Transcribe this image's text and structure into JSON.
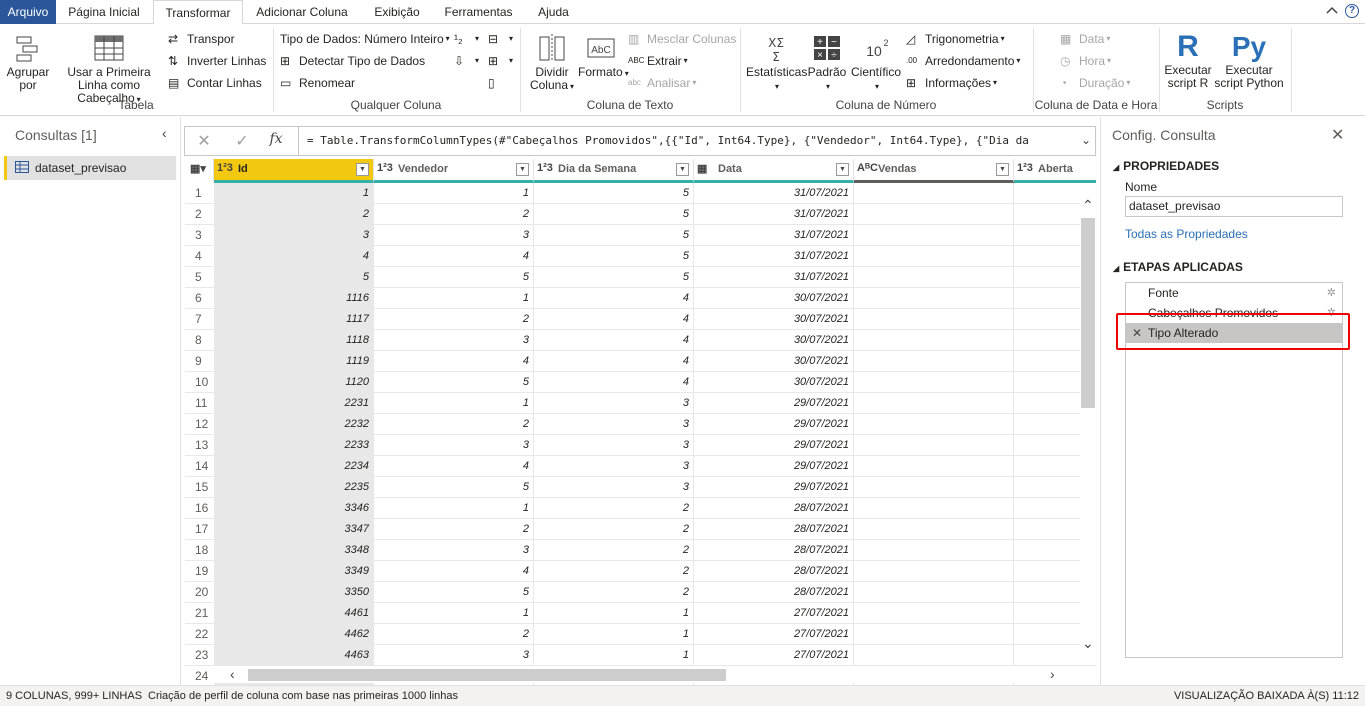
{
  "menu": {
    "tabs": [
      "Arquivo",
      "Página Inicial",
      "Transformar",
      "Adicionar Coluna",
      "Exibição",
      "Ferramentas",
      "Ajuda"
    ]
  },
  "ribbon": {
    "groups": {
      "tabela": "Tabela",
      "qualquer": "Qualquer Coluna",
      "texto": "Coluna de Texto",
      "numero": "Coluna de Número",
      "data": "Coluna de Data e Hora",
      "scripts": "Scripts"
    },
    "agrupar": "Agrupar por",
    "usar_linha": "Usar a Primeira Linha como Cabeçalho",
    "transpor": "Transpor",
    "inverter": "Inverter Linhas",
    "contar": "Contar Linhas",
    "tipo_dados": "Tipo de Dados: Número Inteiro",
    "detectar": "Detectar Tipo de Dados",
    "renomear": "Renomear",
    "dividir": "Dividir Coluna",
    "formato": "Formato",
    "mesclar": "Mesclar Colunas",
    "extrair": "Extrair",
    "analisar": "Analisar",
    "estatisticas": "Estatísticas",
    "padrao": "Padrão",
    "cientifico": "Científico",
    "trig": "Trigonometria",
    "arred": "Arredondamento",
    "info": "Informações",
    "data": "Data",
    "hora": "Hora",
    "duracao": "Duração",
    "script_r": "Executar script R",
    "script_py": "Executar script Python"
  },
  "queries": {
    "title": "Consultas [1]",
    "item": "dataset_previsao"
  },
  "formula": "= Table.TransformColumnTypes(#\"Cabeçalhos Promovidos\",{{\"Id\", Int64.Type}, {\"Vendedor\", Int64.Type}, {\"Dia da",
  "grid": {
    "columns": [
      {
        "type": "1²3",
        "name": "Id"
      },
      {
        "type": "1²3",
        "name": "Vendedor"
      },
      {
        "type": "1²3",
        "name": "Dia da Semana"
      },
      {
        "type": "▦",
        "name": "Data"
      },
      {
        "type": "AᴮC",
        "name": "Vendas"
      },
      {
        "type": "1²3",
        "name": "Aberta"
      }
    ],
    "rows": [
      [
        "1",
        "1",
        "1",
        "5",
        "31/07/2021"
      ],
      [
        "2",
        "2",
        "2",
        "5",
        "31/07/2021"
      ],
      [
        "3",
        "3",
        "3",
        "5",
        "31/07/2021"
      ],
      [
        "4",
        "4",
        "4",
        "5",
        "31/07/2021"
      ],
      [
        "5",
        "5",
        "5",
        "5",
        "31/07/2021"
      ],
      [
        "6",
        "1116",
        "1",
        "4",
        "30/07/2021"
      ],
      [
        "7",
        "1117",
        "2",
        "4",
        "30/07/2021"
      ],
      [
        "8",
        "1118",
        "3",
        "4",
        "30/07/2021"
      ],
      [
        "9",
        "1119",
        "4",
        "4",
        "30/07/2021"
      ],
      [
        "10",
        "1120",
        "5",
        "4",
        "30/07/2021"
      ],
      [
        "11",
        "2231",
        "1",
        "3",
        "29/07/2021"
      ],
      [
        "12",
        "2232",
        "2",
        "3",
        "29/07/2021"
      ],
      [
        "13",
        "2233",
        "3",
        "3",
        "29/07/2021"
      ],
      [
        "14",
        "2234",
        "4",
        "3",
        "29/07/2021"
      ],
      [
        "15",
        "2235",
        "5",
        "3",
        "29/07/2021"
      ],
      [
        "16",
        "3346",
        "1",
        "2",
        "28/07/2021"
      ],
      [
        "17",
        "3347",
        "2",
        "2",
        "28/07/2021"
      ],
      [
        "18",
        "3348",
        "3",
        "2",
        "28/07/2021"
      ],
      [
        "19",
        "3349",
        "4",
        "2",
        "28/07/2021"
      ],
      [
        "20",
        "3350",
        "5",
        "2",
        "28/07/2021"
      ],
      [
        "21",
        "4461",
        "1",
        "1",
        "27/07/2021"
      ],
      [
        "22",
        "4462",
        "2",
        "1",
        "27/07/2021"
      ],
      [
        "23",
        "4463",
        "3",
        "1",
        "27/07/2021"
      ],
      [
        "24",
        "",
        "",
        "",
        ""
      ]
    ]
  },
  "settings": {
    "title": "Config. Consulta",
    "props": "PROPRIEDADES",
    "name_label": "Nome",
    "name_value": "dataset_previsao",
    "all_props": "Todas as Propriedades",
    "steps_title": "ETAPAS APLICADAS",
    "steps": [
      "Fonte",
      "Cabeçalhos Promovidos",
      "Tipo Alterado"
    ]
  },
  "status": {
    "cols": "9 COLUNAS, 999+ LINHAS",
    "profile": "Criação de perfil de coluna com base nas primeiras 1000 linhas",
    "preview": "VISUALIZAÇÃO BAIXADA À(S) 11:12"
  }
}
